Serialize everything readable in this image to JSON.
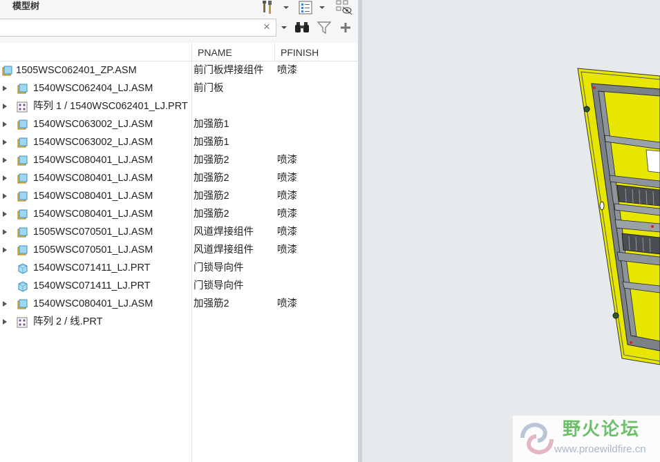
{
  "panel": {
    "title": "模型树"
  },
  "search": {
    "value": "",
    "placeholder": ""
  },
  "icons": {
    "tools": "tools-icon",
    "tree_settings": "tree-settings-icon",
    "show_hide": "show-hide-icon",
    "binoculars": "binoculars-icon",
    "filter": "filter-icon",
    "add": "add-icon",
    "clear": "×"
  },
  "columns": {
    "c1": "",
    "c2": "PNAME",
    "c3": "PFINISH"
  },
  "rows": [
    {
      "type": "asm",
      "level": 0,
      "arrow": false,
      "name": "1505WSC062401_ZP.ASM",
      "pname": "前门板焊接组件",
      "pfinish": "喷漆"
    },
    {
      "type": "asm",
      "level": 1,
      "arrow": true,
      "name": "1540WSC062404_LJ.ASM",
      "pname": "前门板",
      "pfinish": ""
    },
    {
      "type": "pattern",
      "level": 1,
      "arrow": true,
      "name": "阵列 1 / 1540WSC062401_LJ.PRT",
      "pname": "",
      "pfinish": ""
    },
    {
      "type": "asm",
      "level": 1,
      "arrow": true,
      "name": "1540WSC063002_LJ.ASM",
      "pname": "加强筋1",
      "pfinish": ""
    },
    {
      "type": "asm",
      "level": 1,
      "arrow": true,
      "name": "1540WSC063002_LJ.ASM",
      "pname": "加强筋1",
      "pfinish": ""
    },
    {
      "type": "asm",
      "level": 1,
      "arrow": true,
      "name": "1540WSC080401_LJ.ASM",
      "pname": "加强筋2",
      "pfinish": "喷漆"
    },
    {
      "type": "asm",
      "level": 1,
      "arrow": true,
      "name": "1540WSC080401_LJ.ASM",
      "pname": "加强筋2",
      "pfinish": "喷漆"
    },
    {
      "type": "asm",
      "level": 1,
      "arrow": true,
      "name": "1540WSC080401_LJ.ASM",
      "pname": "加强筋2",
      "pfinish": "喷漆"
    },
    {
      "type": "asm",
      "level": 1,
      "arrow": true,
      "name": "1540WSC080401_LJ.ASM",
      "pname": "加强筋2",
      "pfinish": "喷漆"
    },
    {
      "type": "asm",
      "level": 1,
      "arrow": true,
      "name": "1505WSC070501_LJ.ASM",
      "pname": "风道焊接组件",
      "pfinish": "喷漆"
    },
    {
      "type": "asm",
      "level": 1,
      "arrow": true,
      "name": "1505WSC070501_LJ.ASM",
      "pname": "风道焊接组件",
      "pfinish": "喷漆"
    },
    {
      "type": "prt",
      "level": 1,
      "arrow": false,
      "name": "1540WSC071411_LJ.PRT",
      "pname": "门锁导向件",
      "pfinish": ""
    },
    {
      "type": "prt",
      "level": 1,
      "arrow": false,
      "name": "1540WSC071411_LJ.PRT",
      "pname": "门锁导向件",
      "pfinish": ""
    },
    {
      "type": "asm",
      "level": 1,
      "arrow": true,
      "name": "1540WSC080401_LJ.ASM",
      "pname": "加强筋2",
      "pfinish": "喷漆"
    },
    {
      "type": "pattern",
      "level": 1,
      "arrow": true,
      "name": "阵列 2 / 线.PRT",
      "pname": "",
      "pfinish": ""
    }
  ],
  "watermark": {
    "cn": "野火论坛",
    "url": "www.proewildfire.cn"
  },
  "colors": {
    "model_yellow": "#e6e600",
    "model_frame": "#707880",
    "viewport_bg": "#e7eaed",
    "asm_icon": "#e8b830",
    "prt_icon": "#4fb3e6",
    "pattern_icon": "#7a4fa0"
  }
}
